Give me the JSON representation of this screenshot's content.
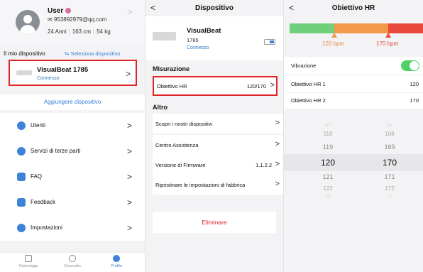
{
  "profile": {
    "user_name": "User",
    "email": "953892979@qq.com",
    "age": "24 Anni",
    "height": "163 cm",
    "weight": "54 kg",
    "section_title": "Il mio dispositivo",
    "select_link": "Seleziona dispositivo",
    "device": {
      "name": "VisualBeat 1785",
      "status": "Connesso"
    },
    "add_device": "Aggiungere dispositivo",
    "menu": [
      {
        "label": "Utenti",
        "icon": "users-icon"
      },
      {
        "label": "Servizi di terze parti",
        "icon": "grid-apps-icon"
      },
      {
        "label": "FAQ",
        "icon": "faq-icon"
      },
      {
        "label": "Feedback",
        "icon": "chat-bubble-icon"
      },
      {
        "label": "Impostazioni",
        "icon": "gear-icon"
      }
    ],
    "tabs": [
      {
        "label": "Cronologia",
        "icon": "history-icon"
      },
      {
        "label": "Cruscotto",
        "icon": "dashboard-icon"
      },
      {
        "label": "Profilo",
        "icon": "profile-icon"
      }
    ],
    "active_tab": "Profilo"
  },
  "device_page": {
    "title": "Dispositivo",
    "name": "VisualBeat",
    "model": "1785",
    "status": "Connesso",
    "section_measure": "Misurazione",
    "hr_target_label": "Obiettivo HR",
    "hr_target_value": "120/170",
    "section_other": "Altro",
    "other_rows": [
      {
        "label": "Scopri i nostri dispositivi",
        "value": ""
      },
      {
        "label": "Centro Assistenza",
        "value": ""
      },
      {
        "label": "Versione di Firmware",
        "value": "1.1.2.2"
      },
      {
        "label": "Ripristinare le impostazioni di fabbrica",
        "value": ""
      }
    ],
    "delete_label": "Eliminare"
  },
  "hr_page": {
    "title": "Obiettivo HR",
    "low_marker": "120 bpm",
    "high_marker": "170 bpm",
    "vibration_label": "Vibrazione",
    "vibration_on": true,
    "hr1_label": "Obiettivo HR 1",
    "hr1_value": "120",
    "hr2_label": "Obiettivo HR 2",
    "hr2_value": "170",
    "picker_left": [
      "117",
      "118",
      "119",
      "120",
      "121",
      "122",
      "123"
    ],
    "picker_right": [
      "167",
      "168",
      "169",
      "170",
      "171",
      "172",
      "173"
    ]
  },
  "colors": {
    "accent": "#3e83d8",
    "highlight": "#e02424",
    "zone_green": "#6fcf7a",
    "zone_orange": "#f29a4a",
    "zone_red": "#ea4a3c",
    "toggle_on": "#4cd264"
  }
}
